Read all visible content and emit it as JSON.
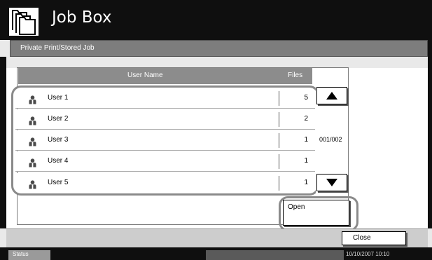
{
  "window": {
    "title": "Job Box",
    "icon": "job-box-folders-icon"
  },
  "subtitle": "Private Print/Stored Job",
  "list": {
    "headers": {
      "user_name": "User Name",
      "files": "Files"
    },
    "rows": [
      {
        "name": "User 1",
        "files": "5"
      },
      {
        "name": "User 2",
        "files": "2"
      },
      {
        "name": "User 3",
        "files": "1"
      },
      {
        "name": "User 4",
        "files": "1"
      },
      {
        "name": "User 5",
        "files": "1"
      }
    ],
    "row_icon": "user-icon",
    "page_indicator": "001/002"
  },
  "buttons": {
    "scroll_up_icon": "triangle-up-icon",
    "scroll_down_icon": "triangle-down-icon",
    "open": "Open",
    "close": "Close"
  },
  "status_bar": {
    "label": "Status",
    "datetime": "10/10/2007   10:10"
  },
  "colors": {
    "title_bar": "#0f0f0f",
    "subtitle_bar": "#7d7d7d",
    "header_bar": "#8c8c8c",
    "highlight_outline": "#8a8a8a"
  }
}
